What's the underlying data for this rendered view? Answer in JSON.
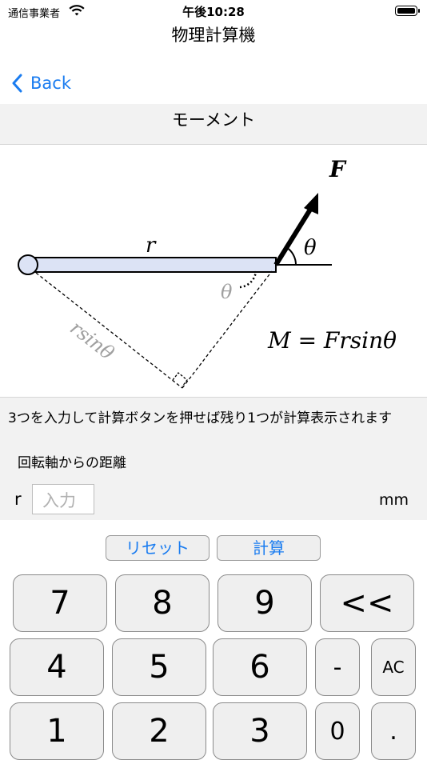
{
  "status_bar": {
    "carrier": "通信事業者",
    "time": "午後10:28"
  },
  "nav": {
    "title": "物理計算機",
    "back_label": "Back"
  },
  "section": {
    "title": "モーメント"
  },
  "diagram": {
    "force_label": "F",
    "radius_label": "r",
    "angle_label": "θ",
    "angle_label_inner": "θ",
    "perp_label": "rsinθ",
    "formula": "M = Frsinθ"
  },
  "instructions": {
    "text": "3つを入力して計算ボタンを押せば残り1つが計算表示されます",
    "subtitle": "回転軸からの距離"
  },
  "input_row": {
    "variable": "r",
    "placeholder": "入力",
    "unit": "mm"
  },
  "actions": {
    "reset_label": "リセット",
    "calc_label": "計算"
  },
  "keypad": {
    "k7": "7",
    "k8": "8",
    "k9": "9",
    "backspace": "<<",
    "k4": "4",
    "k5": "5",
    "k6": "6",
    "minus": "-",
    "clear": "AC",
    "k1": "1",
    "k2": "2",
    "k3": "3",
    "k0": "0",
    "dot": "."
  },
  "colors": {
    "accent": "#1a7cf0",
    "bar_fill": "#dce3f5"
  }
}
